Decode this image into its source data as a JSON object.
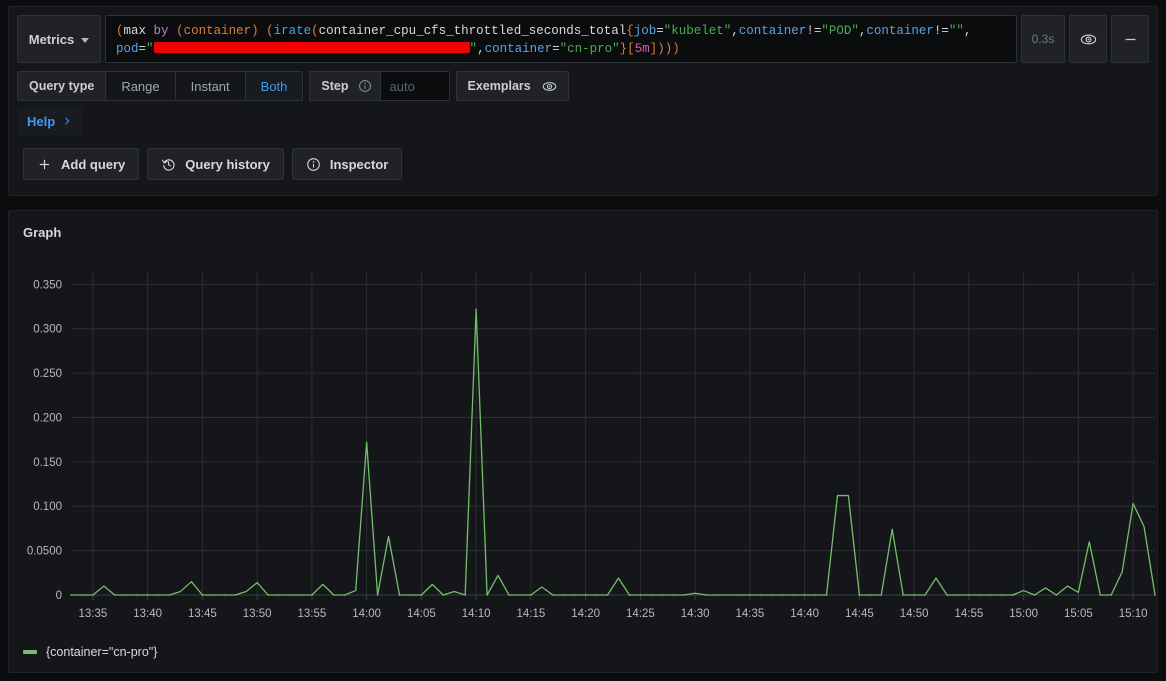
{
  "editor": {
    "metrics_button": "Metrics",
    "metrics_icon": "chevron-down-icon",
    "duration_badge": "0.3s",
    "eye_icon": "eye-icon",
    "collapse_icon": "minus-icon",
    "query": {
      "line1_tokens": "(max by (container) (irate(container_cpu_cfs_throttled_seconds_total{job=\"kubelet\",container!=\"POD\",container!=\"\",",
      "line2_tokens": "pod=\"[REDACTED]\",container=\"cn-pro\"}[5m])))",
      "parts": {
        "open_paren": "(",
        "max": "max",
        "by": "by",
        "group_open": "(container)",
        "irate": "irate",
        "metric": "container_cpu_cfs_throttled_seconds_total",
        "brace_open": "{",
        "label_job": "job",
        "value_job": "\"kubelet\"",
        "label_container_ne_pod": "container",
        "op_ne": "!=",
        "value_pod": "\"POD\"",
        "label_container_ne_empty": "container",
        "value_empty": "\"\"",
        "label_pod": "pod",
        "value_pod_redacted": "",
        "label_container": "container",
        "value_container": "\"cn-pro\"",
        "brace_close": "}",
        "range": "[5m]",
        "close_parens": ")))"
      }
    }
  },
  "query_type": {
    "label": "Query type",
    "options": [
      "Range",
      "Instant",
      "Both"
    ],
    "selected": "Both",
    "step": {
      "label": "Step",
      "info_icon": "info-circle-icon",
      "placeholder": "auto",
      "value": ""
    },
    "exemplars": {
      "label": "Exemplars",
      "icon": "eye-icon"
    }
  },
  "help": {
    "label": "Help",
    "icon": "chevron-right-icon"
  },
  "actions": [
    {
      "label": "Add query",
      "icon": "plus-icon"
    },
    {
      "label": "Query history",
      "icon": "history-icon"
    },
    {
      "label": "Inspector",
      "icon": "info-circle-icon"
    }
  ],
  "panel": {
    "title": "Graph",
    "legend_label": "{container=\"cn-pro\"}",
    "series_color": "#73bf69"
  },
  "chart_data": {
    "type": "line",
    "title": "Graph",
    "xlabel": "",
    "ylabel": "",
    "ylim": [
      0,
      0.365
    ],
    "xlim": [
      "13:33",
      "15:12"
    ],
    "grid": true,
    "legend_position": "bottom-left",
    "ytick_labels": [
      "0",
      "0.0500",
      "0.100",
      "0.150",
      "0.200",
      "0.250",
      "0.300",
      "0.350"
    ],
    "ytick_values": [
      0,
      0.05,
      0.1,
      0.15,
      0.2,
      0.25,
      0.3,
      0.35
    ],
    "xtick_labels": [
      "13:35",
      "13:40",
      "13:45",
      "13:50",
      "13:55",
      "14:00",
      "14:05",
      "14:10",
      "14:15",
      "14:20",
      "14:25",
      "14:30",
      "14:35",
      "14:40",
      "14:45",
      "14:50",
      "14:55",
      "15:00",
      "15:05",
      "15:10"
    ],
    "series": [
      {
        "name": "{container=\"cn-pro\"}",
        "color": "#73bf69",
        "unit": "",
        "points": [
          {
            "t": "13:33",
            "v": 0.0
          },
          {
            "t": "13:34",
            "v": 0.0
          },
          {
            "t": "13:35",
            "v": 0.0
          },
          {
            "t": "13:36",
            "v": 0.01
          },
          {
            "t": "13:37",
            "v": 0.0
          },
          {
            "t": "13:38",
            "v": 0.0
          },
          {
            "t": "13:39",
            "v": 0.0
          },
          {
            "t": "13:40",
            "v": 0.0
          },
          {
            "t": "13:41",
            "v": 0.0
          },
          {
            "t": "13:42",
            "v": 0.0
          },
          {
            "t": "13:43",
            "v": 0.004
          },
          {
            "t": "13:44",
            "v": 0.015
          },
          {
            "t": "13:45",
            "v": 0.0
          },
          {
            "t": "13:46",
            "v": 0.0
          },
          {
            "t": "13:47",
            "v": 0.0
          },
          {
            "t": "13:48",
            "v": 0.0
          },
          {
            "t": "13:49",
            "v": 0.004
          },
          {
            "t": "13:50",
            "v": 0.014
          },
          {
            "t": "13:51",
            "v": 0.0
          },
          {
            "t": "13:52",
            "v": 0.0
          },
          {
            "t": "13:53",
            "v": 0.0
          },
          {
            "t": "13:54",
            "v": 0.0
          },
          {
            "t": "13:55",
            "v": 0.0
          },
          {
            "t": "13:56",
            "v": 0.012
          },
          {
            "t": "13:57",
            "v": 0.0
          },
          {
            "t": "13:58",
            "v": 0.0
          },
          {
            "t": "13:59",
            "v": 0.005
          },
          {
            "t": "14:00",
            "v": 0.172
          },
          {
            "t": "14:01",
            "v": 0.0
          },
          {
            "t": "14:02",
            "v": 0.066
          },
          {
            "t": "14:03",
            "v": 0.0
          },
          {
            "t": "14:04",
            "v": 0.0
          },
          {
            "t": "14:05",
            "v": 0.0
          },
          {
            "t": "14:06",
            "v": 0.012
          },
          {
            "t": "14:07",
            "v": 0.0
          },
          {
            "t": "14:08",
            "v": 0.004
          },
          {
            "t": "14:09",
            "v": 0.0
          },
          {
            "t": "14:10",
            "v": 0.322
          },
          {
            "t": "14:11",
            "v": 0.0
          },
          {
            "t": "14:12",
            "v": 0.022
          },
          {
            "t": "14:13",
            "v": 0.0
          },
          {
            "t": "14:14",
            "v": 0.0
          },
          {
            "t": "14:15",
            "v": 0.0
          },
          {
            "t": "14:16",
            "v": 0.009
          },
          {
            "t": "14:17",
            "v": 0.0
          },
          {
            "t": "14:18",
            "v": 0.0
          },
          {
            "t": "14:19",
            "v": 0.0
          },
          {
            "t": "14:20",
            "v": 0.0
          },
          {
            "t": "14:21",
            "v": 0.0
          },
          {
            "t": "14:22",
            "v": 0.0
          },
          {
            "t": "14:23",
            "v": 0.019
          },
          {
            "t": "14:24",
            "v": 0.0
          },
          {
            "t": "14:25",
            "v": 0.0
          },
          {
            "t": "14:26",
            "v": 0.0
          },
          {
            "t": "14:27",
            "v": 0.0
          },
          {
            "t": "14:28",
            "v": 0.0
          },
          {
            "t": "14:29",
            "v": 0.0
          },
          {
            "t": "14:30",
            "v": 0.002
          },
          {
            "t": "14:31",
            "v": 0.0
          },
          {
            "t": "14:32",
            "v": 0.0
          },
          {
            "t": "14:33",
            "v": 0.0
          },
          {
            "t": "14:34",
            "v": 0.0
          },
          {
            "t": "14:35",
            "v": 0.0
          },
          {
            "t": "14:36",
            "v": 0.0
          },
          {
            "t": "14:37",
            "v": 0.0
          },
          {
            "t": "14:38",
            "v": 0.0
          },
          {
            "t": "14:39",
            "v": 0.0
          },
          {
            "t": "14:40",
            "v": 0.0
          },
          {
            "t": "14:41",
            "v": 0.0
          },
          {
            "t": "14:42",
            "v": 0.0
          },
          {
            "t": "14:43",
            "v": 0.112
          },
          {
            "t": "14:44",
            "v": 0.112
          },
          {
            "t": "14:45",
            "v": 0.0
          },
          {
            "t": "14:46",
            "v": 0.0
          },
          {
            "t": "14:47",
            "v": 0.0
          },
          {
            "t": "14:48",
            "v": 0.074
          },
          {
            "t": "14:49",
            "v": 0.0
          },
          {
            "t": "14:50",
            "v": 0.0
          },
          {
            "t": "14:51",
            "v": 0.0
          },
          {
            "t": "14:52",
            "v": 0.019
          },
          {
            "t": "14:53",
            "v": 0.0
          },
          {
            "t": "14:54",
            "v": 0.0
          },
          {
            "t": "14:55",
            "v": 0.0
          },
          {
            "t": "14:56",
            "v": 0.0
          },
          {
            "t": "14:57",
            "v": 0.0
          },
          {
            "t": "14:58",
            "v": 0.0
          },
          {
            "t": "14:59",
            "v": 0.0
          },
          {
            "t": "15:00",
            "v": 0.005
          },
          {
            "t": "15:01",
            "v": 0.0
          },
          {
            "t": "15:02",
            "v": 0.008
          },
          {
            "t": "15:03",
            "v": 0.0
          },
          {
            "t": "15:04",
            "v": 0.01
          },
          {
            "t": "15:05",
            "v": 0.003
          },
          {
            "t": "15:06",
            "v": 0.06
          },
          {
            "t": "15:07",
            "v": 0.0
          },
          {
            "t": "15:08",
            "v": 0.0
          },
          {
            "t": "15:09",
            "v": 0.026
          },
          {
            "t": "15:10",
            "v": 0.103
          },
          {
            "t": "15:11",
            "v": 0.077
          },
          {
            "t": "15:12",
            "v": 0.0
          }
        ]
      }
    ]
  }
}
